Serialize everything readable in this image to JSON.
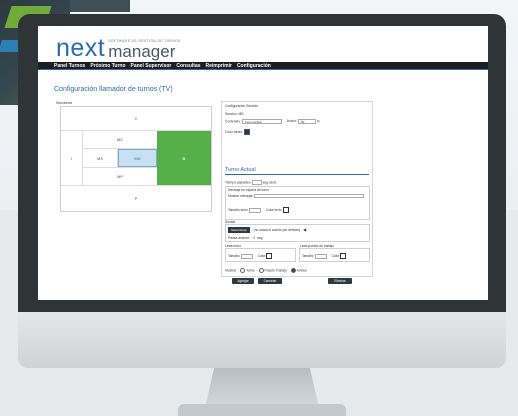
{
  "brand": {
    "next": "next",
    "manager": "manager",
    "tagline": "SOFTWARE DE GESTIÓN DE TURNOS"
  },
  "nav": [
    "Panel Turnos",
    "Próximo Turno",
    "Panel Supervisor",
    "Consultas",
    "Reimprimir",
    "Configuración"
  ],
  "page_title": "Configuración llamador de turnos (TV)",
  "sections": {
    "label": "Secciones",
    "cells": {
      "top": "C",
      "left": "I",
      "mc": "MC",
      "ms": "MS",
      "md": "MD",
      "mp": "MP",
      "d": "D",
      "bottom": "P"
    }
  },
  "config": {
    "title": "Configuración Sección",
    "seccion": "Sección: MD",
    "contenido_label": "Contenido:",
    "contenido_value": "Turno Actual",
    "ancho_label": "Ancho:",
    "ancho_value": "50",
    "percent": "%",
    "color_fondo": "Color fondo:"
  },
  "turno": {
    "title": "Turno Actual",
    "tiempo_label": "Tiempo parpadeo",
    "tiempo_unit": "seg./ciclo",
    "mensaje_label": "Mensaje en espera de turno",
    "mostrar_label": "Mostrar mensaje:",
    "tamano_texto": "Tamaño texto",
    "color_texto": "Color texto",
    "sonido_label": "Sonido",
    "sonido_btn": "Seleccionar",
    "sonido_info": "(no usará el sonido por defecto)",
    "pausa_label": "Pausa anterior",
    "pausa_value": "2",
    "pausa_unit": "seg.",
    "letra_turno": "Letra turno",
    "letra_puesto": "Letra puesto de trabajo",
    "tamano": "Tamaño",
    "color": "Color",
    "mostrar": "Mostrar",
    "opt_turno": "Turno",
    "opt_puesto": "Puesto Trabajo",
    "opt_ambos": "Ambos"
  },
  "buttons": {
    "agregar": "Agregar",
    "cancelar": "Cancelar",
    "eliminar": "Eliminar"
  },
  "colors": {
    "accent": "#2b6cb0",
    "green": "#55b04a",
    "dark": "#2d3a40"
  }
}
